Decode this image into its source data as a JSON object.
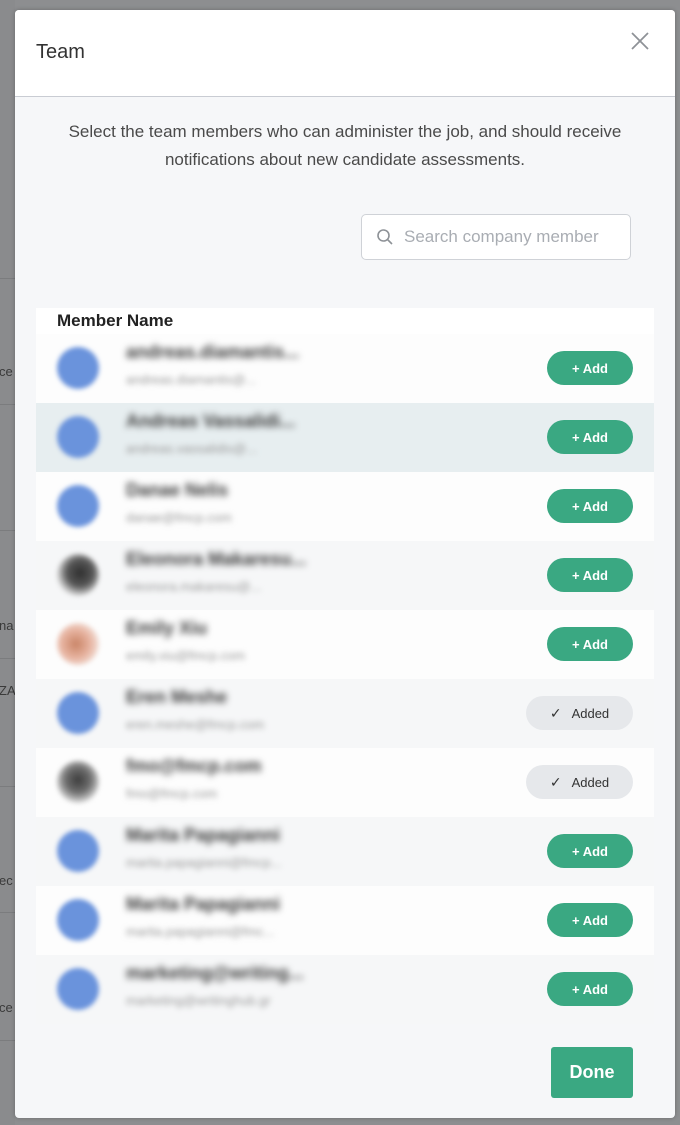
{
  "modal": {
    "title": "Team",
    "close_icon": "close-icon",
    "intro_line1": "Select the team members who can administer the job, and should receive",
    "intro_line2": "notifications about new candidate assessments.",
    "search": {
      "placeholder": "Search company member",
      "value": ""
    },
    "table": {
      "column_header": "Member Name",
      "rows": [
        {
          "name": "andreas.diamantis...",
          "email": "andreas.diamantis@...",
          "action": "+ Add"
        },
        {
          "name": "Andreas Vassalidi...",
          "email": "andreas.vassalidis@...",
          "action": "+ Add"
        },
        {
          "name": "Danae Nelis",
          "email": "danae@fmcp.com",
          "action": "+ Add"
        },
        {
          "name": "Eleonora Makaresu...",
          "email": "eleonora.makaresu@...",
          "action": "+ Add"
        },
        {
          "name": "Emily Xiu",
          "email": "emily.xiu@fmcp.com",
          "action": "+ Add"
        },
        {
          "name": "Eren Meshe",
          "email": "eren.meshe@fmcp.com",
          "action": "Added"
        },
        {
          "name": "fmo@fmcp.com",
          "email": "fmo@fmcp.com",
          "action": "Added"
        },
        {
          "name": "Marita Papagianni",
          "email": "marita.papagianni@fmcp...",
          "action": "+ Add"
        },
        {
          "name": "Marita Papagianni",
          "email": "marita.papagianni@fmc...",
          "action": "+ Add"
        },
        {
          "name": "marketing@writing...",
          "email": "marketing@writinghub.gr",
          "action": "+ Add"
        }
      ]
    },
    "done_label": "Done"
  },
  "background": {
    "peek_texts": [
      "ce",
      "na",
      "ZA",
      "ec",
      "ce"
    ]
  },
  "colors": {
    "accent": "#3aa882",
    "added_bg": "#e6e8eb",
    "avatar_default": "#6a93dc"
  }
}
